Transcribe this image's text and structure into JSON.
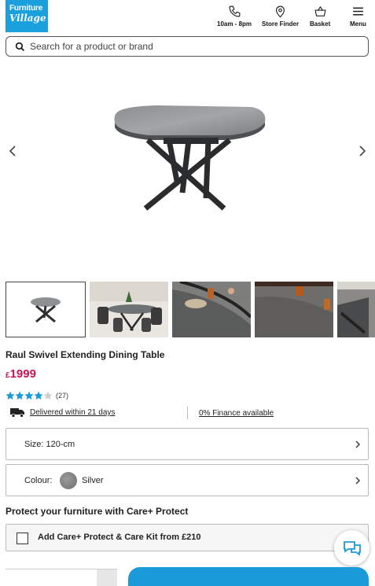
{
  "header": {
    "logo_line1": "Furniture",
    "logo_line2": "Village",
    "hours_label": "10am - 8pm",
    "store_finder_label": "Store Finder",
    "basket_label": "Basket",
    "menu_label": "Menu"
  },
  "search": {
    "placeholder": "Search for a product or brand",
    "value": ""
  },
  "product": {
    "title": "Raul Swivel Extending Dining Table",
    "currency": "£",
    "price": "1999",
    "rating": 4.5,
    "review_count": "(27)",
    "delivery_text": "Delivered within 21 days",
    "finance_text": "0% Finance available"
  },
  "options": {
    "size_label": "Size: 120-cm",
    "colour_label": "Colour:",
    "colour_value": "Silver"
  },
  "care": {
    "title": "Protect your furniture with Care+ Protect",
    "checkbox_label": "Add Care+ Protect & Care Kit from £210",
    "checked": false
  },
  "gallery": {
    "selected_index": 0,
    "count": 5
  },
  "colors": {
    "brand_blue": "#1aa1dd",
    "price_pink": "#c2185b",
    "star_teal": "#1a9ad9",
    "button_blue": "#1a9ad9"
  },
  "icons": [
    "phone-icon",
    "location-pin-icon",
    "basket-icon",
    "menu-icon",
    "search-icon",
    "chevron-left-icon",
    "chevron-right-icon",
    "truck-icon",
    "chat-icon"
  ]
}
